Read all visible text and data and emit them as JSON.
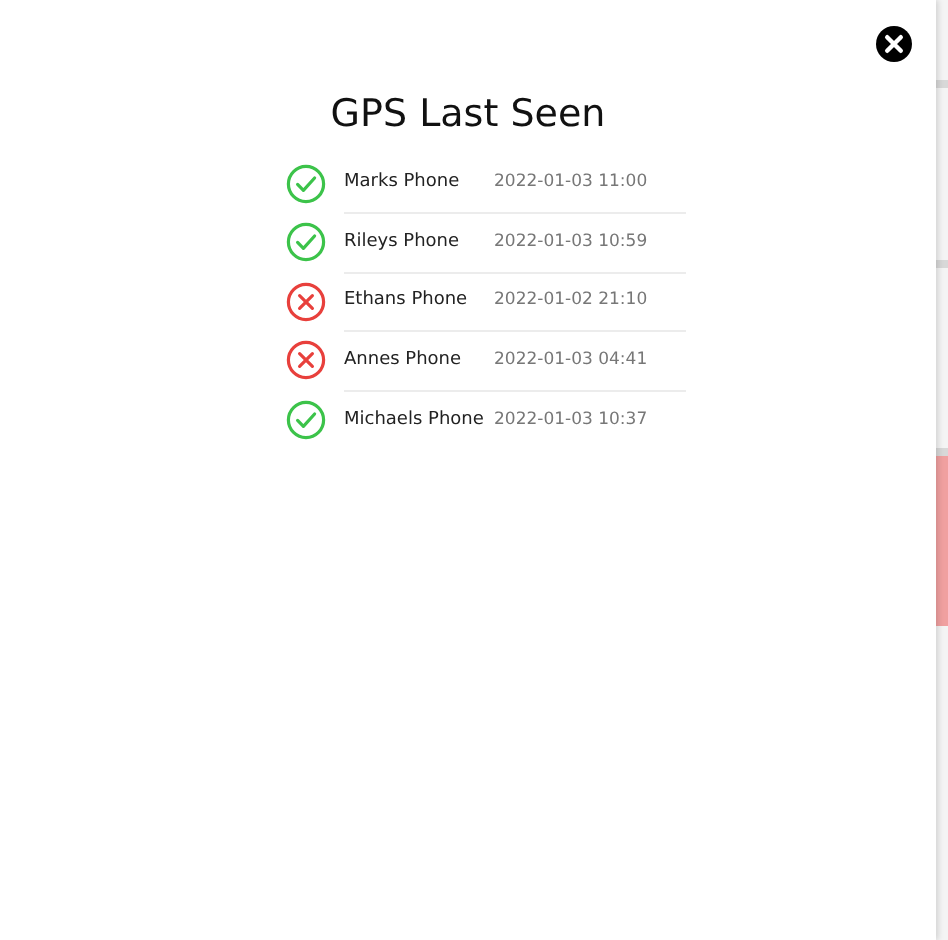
{
  "dialog": {
    "title": "GPS Last Seen",
    "devices": [
      {
        "name": "Marks Phone",
        "last_seen": "2022-01-03 11:00",
        "kind": "ok"
      },
      {
        "name": "Rileys Phone",
        "last_seen": "2022-01-03 10:59",
        "kind": "ok"
      },
      {
        "name": "Ethans Phone",
        "last_seen": "2022-01-02 21:10",
        "kind": "fail"
      },
      {
        "name": "Annes Phone",
        "last_seen": "2022-01-03 04:41",
        "kind": "fail"
      },
      {
        "name": "Michaels Phone",
        "last_seen": "2022-01-03 10:37",
        "kind": "ok"
      }
    ]
  }
}
